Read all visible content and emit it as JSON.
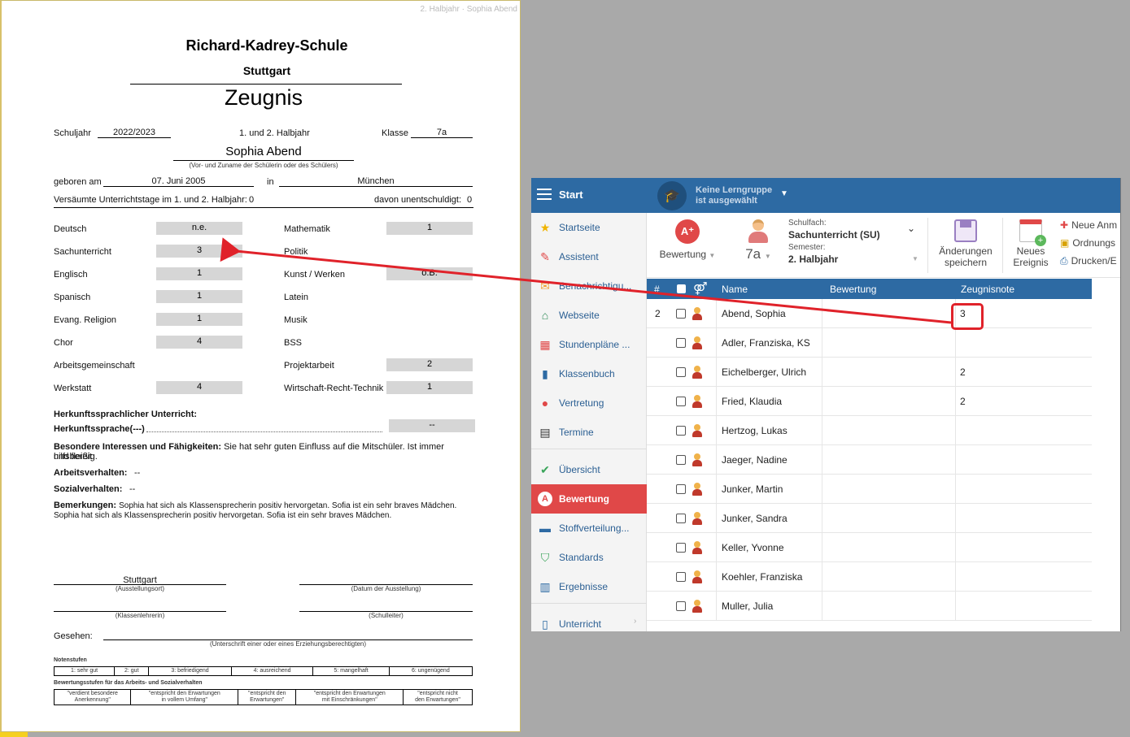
{
  "document": {
    "header_faint": "2. Halbjahr · Sophia Abend",
    "school": "Richard-Kadrey-Schule",
    "city": "Stuttgart",
    "title": "Zeugnis",
    "schuljahr_label": "Schuljahr",
    "schuljahr": "2022/2023",
    "halbjahr": "1. und 2. Halbjahr",
    "klasse_label": "Klasse",
    "klasse": "7a",
    "student_name": "Sophia Abend",
    "name_caption": "(Vor- und Zuname der Schülerin oder des Schülers)",
    "born_label": "geboren am",
    "born_date": "07. Juni 2005",
    "in_label": "in",
    "born_place": "München",
    "absence_label": "Versäumte Unterrichtstage im 1. und 2. Halbjahr:",
    "absence_value": "0",
    "unexcused_label": "davon unentschuldigt:",
    "unexcused_value": "0",
    "subjects_left": [
      {
        "name": "Deutsch",
        "grade": "n.e."
      },
      {
        "name": "Sachunterricht",
        "grade": "3"
      },
      {
        "name": "Englisch",
        "grade": "1"
      },
      {
        "name": "Spanisch",
        "grade": "1"
      },
      {
        "name": "Evang. Religion",
        "grade": "1"
      },
      {
        "name": "Chor",
        "grade": "4"
      },
      {
        "name": "Arbeitsgemeinschaft",
        "grade": ""
      },
      {
        "name": "Werkstatt",
        "grade": "4"
      }
    ],
    "subjects_right": [
      {
        "name": "Mathematik",
        "grade": "1"
      },
      {
        "name": "Politik",
        "grade": ""
      },
      {
        "name": "Kunst / Werken",
        "grade": "o.B."
      },
      {
        "name": "Latein",
        "grade": ""
      },
      {
        "name": "Musik",
        "grade": ""
      },
      {
        "name": "BSS",
        "grade": ""
      },
      {
        "name": "Projektarbeit",
        "grade": "2"
      },
      {
        "name": "Wirtschaft-Recht-Technik",
        "grade": "1"
      }
    ],
    "herkunft_title": "Herkunftssprachlicher Unterricht:",
    "herkunft_label": "Herkunftssprache(---)",
    "herkunft_grade": "--",
    "interessen_label": "Besondere Interessen und Fähigkeiten:",
    "interessen_text": "Sie hat sehr guten Einfluss auf die Mitschüler. Ist immer hilfsbereit",
    "interessen_text2": "und fleißig.",
    "arbeit_label": "Arbeitsverhalten:",
    "arbeit_value": "--",
    "sozial_label": "Sozialverhalten:",
    "sozial_value": "--",
    "bemerk_label": "Bemerkungen:",
    "bemerk_text1": "Sophia hat sich als Klassensprecherin positiv hervorgetan. Sofia ist ein sehr braves Mädchen.",
    "bemerk_text2": "Sophia hat sich als Klassensprecherin positiv hervorgetan. Sofia ist ein sehr braves Mädchen.",
    "place_value": "Stuttgart",
    "place_caption": "(Ausstellungsort)",
    "date_caption": "(Datum der Ausstellung)",
    "teacher_caption": "(Klassenlehrerin)",
    "principal_caption": "(Schulleiter)",
    "gesehen_label": "Gesehen:",
    "guardian_caption": "(Unterschrift einer oder eines Erziehungsberechtigten)",
    "notenstufen_title": "Notenstufen",
    "notenstufen": [
      "1: sehr gut",
      "2: gut",
      "3: befriedigend",
      "4: ausreichend",
      "5: mangelhaft",
      "6: ungenügend"
    ],
    "bewertung_title": "Bewertungsstufen für das Arbeits- und Sozialverhalten",
    "bewertungsstufen": [
      [
        "\"verdient besondere",
        "Anerkennung\""
      ],
      [
        "\"entspricht den Erwartungen",
        "in vollem Umfang\""
      ],
      [
        "\"entspricht den",
        "Erwartungen\""
      ],
      [
        "\"entspricht den Erwartungen",
        "mit Einschränkungen\""
      ],
      [
        "\"entspricht nicht",
        "den Erwartungen\""
      ]
    ]
  },
  "app": {
    "start_label": "Start",
    "group_line1": "Keine Lerngruppe",
    "group_line2": "ist ausgewählt",
    "sidebar": [
      {
        "label": "Startseite",
        "icon": "star-icon"
      },
      {
        "label": "Assistent",
        "icon": "wand-icon"
      },
      {
        "label": "Benachrichtigu...",
        "icon": "mail-icon"
      },
      {
        "label": "Webseite",
        "icon": "house-icon"
      },
      {
        "label": "Stundenpläne ...",
        "icon": "calendar-grid-icon"
      },
      {
        "label": "Klassenbuch",
        "icon": "book-icon"
      },
      {
        "label": "Vertretung",
        "icon": "person-icon"
      },
      {
        "label": "Termine",
        "icon": "calendar-icon"
      },
      {
        "label": "Übersicht",
        "icon": "check-circle-icon"
      },
      {
        "label": "Bewertung",
        "icon": "grade-icon"
      },
      {
        "label": "Stoffverteilung...",
        "icon": "briefcase-icon"
      },
      {
        "label": "Standards",
        "icon": "shield-check-icon"
      },
      {
        "label": "Ergebnisse",
        "icon": "bar-chart-icon"
      },
      {
        "label": "Unterricht",
        "icon": "open-book-icon"
      }
    ],
    "toolbar": {
      "bewertung_label": "Bewertung",
      "klasse": "7a",
      "schulfach_label": "Schulfach:",
      "schulfach_value": "Sachunterricht (SU)",
      "semester_label": "Semester:",
      "semester_value": "2. Halbjahr",
      "save_line1": "Änderungen",
      "save_line2": "speichern",
      "event_line1": "Neues",
      "event_line2": "Ereignis",
      "side_items": [
        "Neue Anm",
        "Ordnungs",
        "Drucken/E"
      ]
    },
    "grid": {
      "headers": {
        "num": "#",
        "name": "Name",
        "bewertung": "Bewertung",
        "zeugnisnote": "Zeugnisnote"
      },
      "rows": [
        {
          "num": "2",
          "name": "Abend, Sophia",
          "bewertung": "",
          "note": "3"
        },
        {
          "num": "",
          "name": "Adler, Franziska, KS",
          "bewertung": "",
          "note": ""
        },
        {
          "num": "",
          "name": "Eichelberger, Ulrich",
          "bewertung": "",
          "note": "2"
        },
        {
          "num": "",
          "name": "Fried, Klaudia",
          "bewertung": "",
          "note": "2"
        },
        {
          "num": "",
          "name": "Hertzog, Lukas",
          "bewertung": "",
          "note": ""
        },
        {
          "num": "",
          "name": "Jaeger, Nadine",
          "bewertung": "",
          "note": ""
        },
        {
          "num": "",
          "name": "Junker, Martin",
          "bewertung": "",
          "note": ""
        },
        {
          "num": "",
          "name": "Junker, Sandra",
          "bewertung": "",
          "note": ""
        },
        {
          "num": "",
          "name": "Keller, Yvonne",
          "bewertung": "",
          "note": ""
        },
        {
          "num": "",
          "name": "Koehler, Franziska",
          "bewertung": "",
          "note": ""
        },
        {
          "num": "",
          "name": "Muller, Julia",
          "bewertung": "",
          "note": ""
        }
      ]
    }
  },
  "colors": {
    "accent_blue": "#2d6aa3",
    "active_red": "#e04848",
    "annotation_red": "#e0222a"
  }
}
